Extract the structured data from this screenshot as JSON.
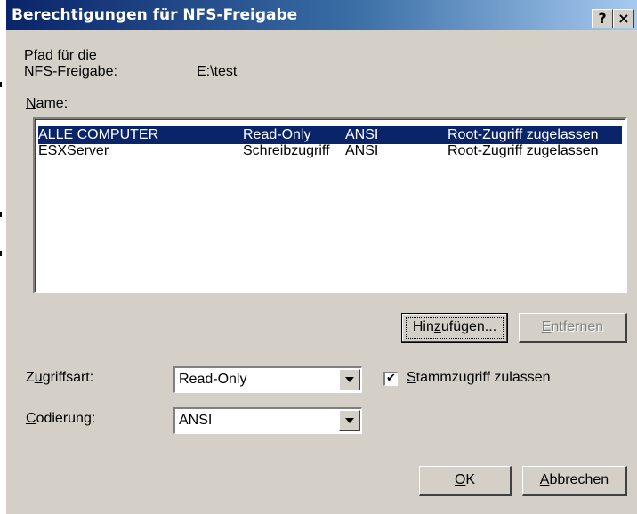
{
  "window": {
    "title": "Berechtigungen für NFS-Freigabe",
    "help_btn": "?",
    "close_btn": "×"
  },
  "path": {
    "label_line1": "Pfad für die",
    "label_line2": "NFS-Freigabe:",
    "value": "E:\\test"
  },
  "name_label": {
    "mnemonic": "N",
    "rest": "ame:"
  },
  "list": {
    "rows": [
      {
        "name": "ALLE COMPUTER",
        "access": "Read-Only",
        "encoding": "ANSI",
        "root": "Root-Zugriff zugelassen",
        "selected": true
      },
      {
        "name": "ESXServer",
        "access": "Schreibzugriff",
        "encoding": "ANSI",
        "root": "Root-Zugriff zugelassen",
        "selected": false
      }
    ]
  },
  "buttons": {
    "add": {
      "before": "Hin",
      "mnemonic": "z",
      "after": "ufügen..."
    },
    "remove": {
      "mnemonic": "E",
      "after": "ntfernen"
    },
    "ok": {
      "mnemonic": "O",
      "after": "K"
    },
    "cancel": {
      "mnemonic": "A",
      "after": "bbrechen"
    }
  },
  "access_type": {
    "label": {
      "before": "Z",
      "mnemonic": "u",
      "after": "griffsart:"
    },
    "value": "Read-Only"
  },
  "encoding": {
    "label": {
      "mnemonic": "C",
      "after": "odierung:"
    },
    "value": "ANSI"
  },
  "root_access": {
    "checked": "✔",
    "label": {
      "mnemonic": "S",
      "after": "tammzugriff zulassen"
    }
  },
  "colors": {
    "title_start": "#0a246a",
    "title_end": "#a6caf0",
    "selection": "#0a246a",
    "face": "#d4d0c8"
  }
}
